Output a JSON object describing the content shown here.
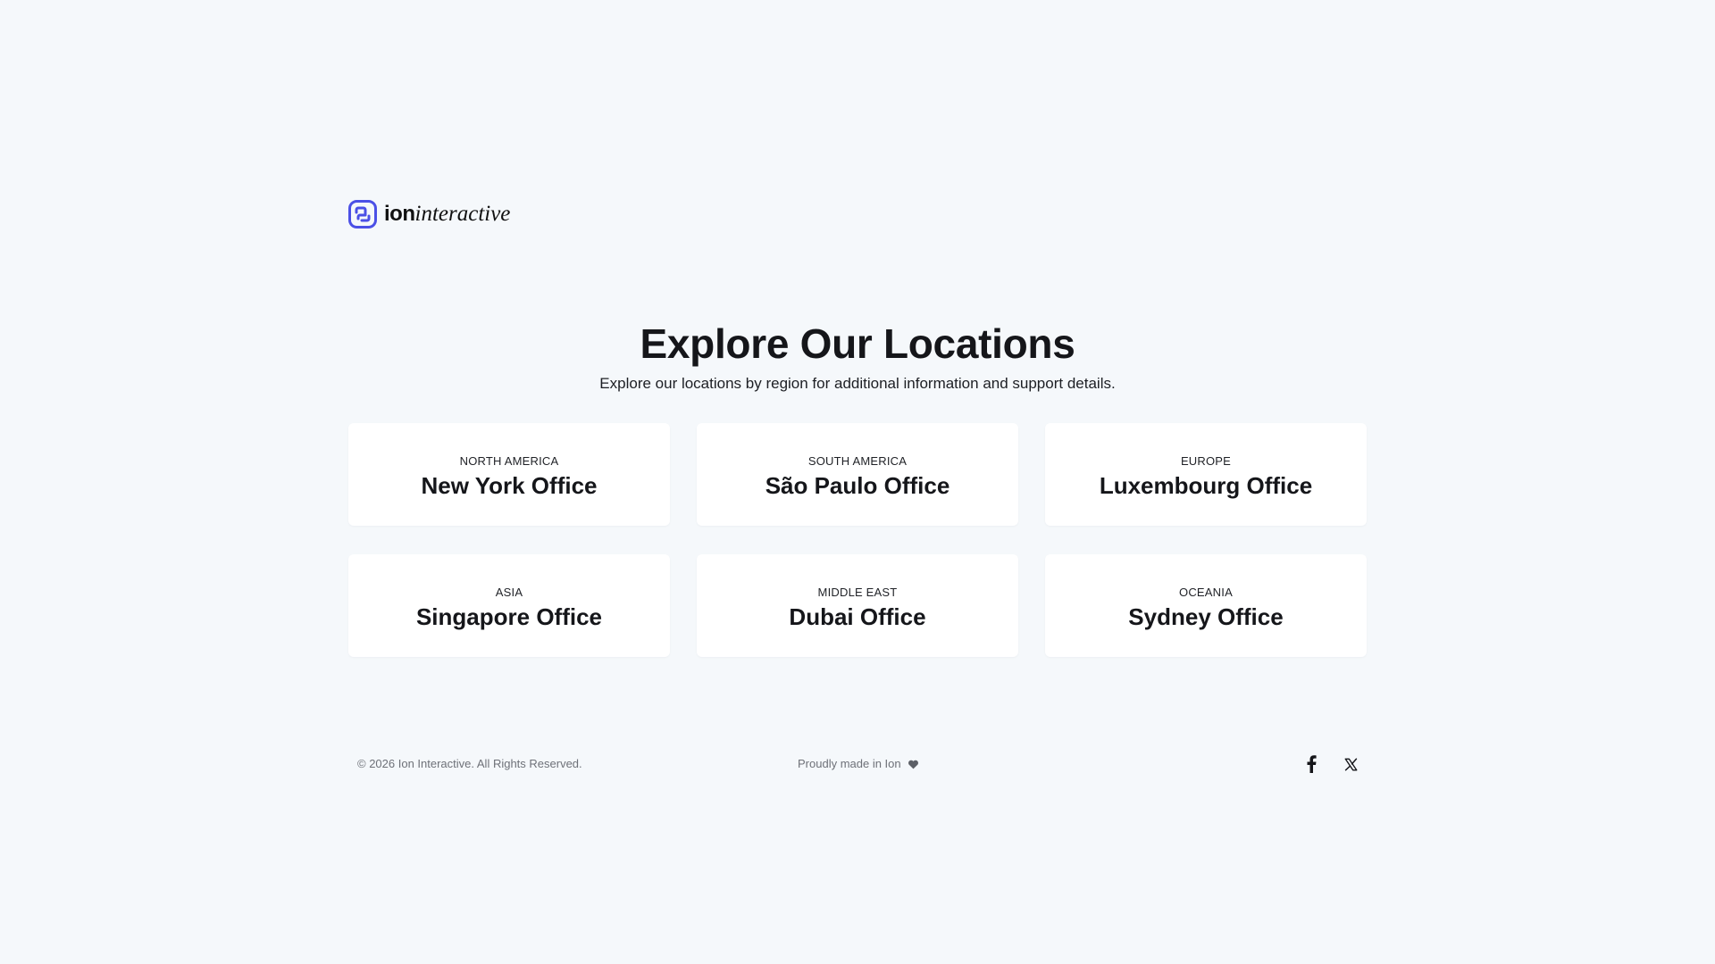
{
  "brand": {
    "name_bold": "ion",
    "name_italic": "interactive",
    "accent_color": "#4b50e6",
    "logo_icon": "ion-logo-icon"
  },
  "hero": {
    "title": "Explore Our Locations",
    "subtitle": "Explore our locations by region for additional information and support details."
  },
  "locations": [
    {
      "region": "NORTH AMERICA",
      "office": "New York Office"
    },
    {
      "region": "SOUTH AMERICA",
      "office": "São Paulo Office"
    },
    {
      "region": "EUROPE",
      "office": "Luxembourg Office"
    },
    {
      "region": "ASIA",
      "office": "Singapore Office"
    },
    {
      "region": "MIDDLE EAST",
      "office": "Dubai Office"
    },
    {
      "region": "OCEANIA",
      "office": "Sydney Office"
    }
  ],
  "footer": {
    "copyright": "© 2026 Ion Interactive. All Rights Reserved.",
    "made_in": "Proudly made in Ion",
    "made_icon": "heart-icon",
    "social": [
      {
        "name": "facebook-icon"
      },
      {
        "name": "x-twitter-icon"
      }
    ]
  },
  "colors": {
    "background": "#f5f8fb",
    "card": "#ffffff",
    "text": "#15161a",
    "muted": "#6e7178"
  }
}
